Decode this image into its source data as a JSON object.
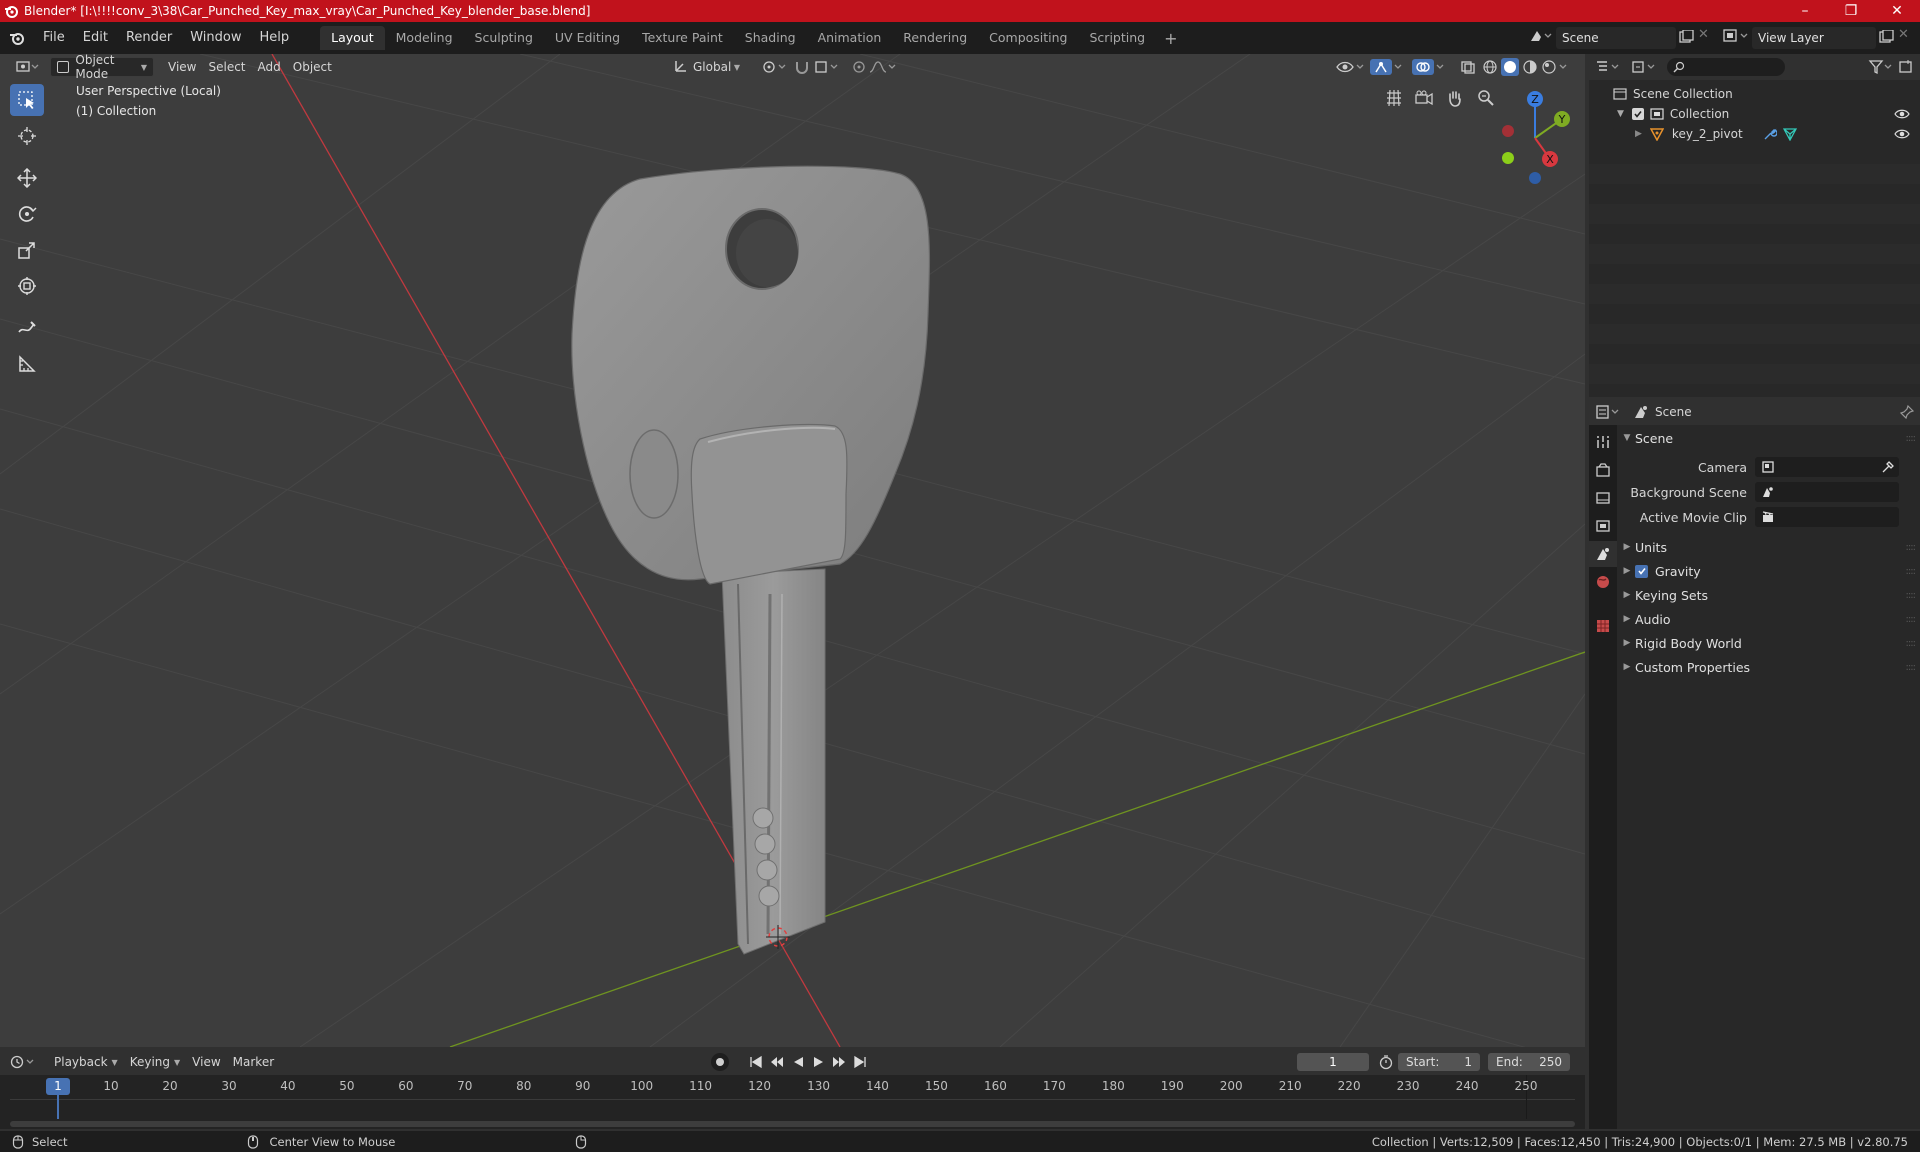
{
  "window": {
    "title": "Blender* [I:\\!!!!conv_3\\38\\Car_Punched_Key_max_vray\\Car_Punched_Key_blender_base.blend]",
    "minimize": "–",
    "maximize": "❐",
    "close": "✕"
  },
  "menu": [
    "File",
    "Edit",
    "Render",
    "Window",
    "Help"
  ],
  "workspaces": [
    "Layout",
    "Modeling",
    "Sculpting",
    "UV Editing",
    "Texture Paint",
    "Shading",
    "Animation",
    "Rendering",
    "Compositing",
    "Scripting"
  ],
  "active_workspace": "Layout",
  "scene_name": "Scene",
  "view_layer": "View Layer",
  "viewport_header": {
    "mode": "Object Mode",
    "menus": [
      "View",
      "Select",
      "Add",
      "Object"
    ],
    "transform_orientation": "Global"
  },
  "viewport": {
    "perspective_label": "User Perspective (Local)",
    "collection_label": "(1) Collection",
    "gizmo_axes": {
      "z": "Z",
      "y": "Y",
      "x": "X"
    }
  },
  "outliner": {
    "search_placeholder": "",
    "scene_collection": "Scene Collection",
    "collection": "Collection",
    "object": "key_2_pivot"
  },
  "properties": {
    "context": "Scene",
    "section": "Scene",
    "camera_label": "Camera",
    "background_scene_label": "Background Scene",
    "active_movie_clip_label": "Active Movie Clip",
    "sections": [
      "Units",
      "Gravity",
      "Keying Sets",
      "Audio",
      "Rigid Body World",
      "Custom Properties"
    ],
    "gravity_checked": true
  },
  "timeline": {
    "menus": [
      "Playback",
      "Keying",
      "View",
      "Marker"
    ],
    "current_frame": "1",
    "start_label": "Start:",
    "start": "1",
    "end_label": "End:",
    "end": "250",
    "ruler": [
      "1",
      "10",
      "20",
      "30",
      "40",
      "50",
      "60",
      "70",
      "80",
      "90",
      "100",
      "110",
      "120",
      "130",
      "140",
      "150",
      "160",
      "170",
      "180",
      "190",
      "200",
      "210",
      "220",
      "230",
      "240",
      "250"
    ]
  },
  "statusbar": {
    "left_action": "Select",
    "middle_action": "Center View to Mouse",
    "stats": "Collection | Verts:12,509 | Faces:12,450 | Tris:24,900 | Objects:0/1 | Mem: 27.5 MB | v2.80.75"
  },
  "colors": {
    "accent": "#4772b3",
    "titlebar": "#c1121c",
    "axis_x": "#d8383f",
    "axis_y": "#7fab23",
    "axis_z": "#3a7de0"
  }
}
